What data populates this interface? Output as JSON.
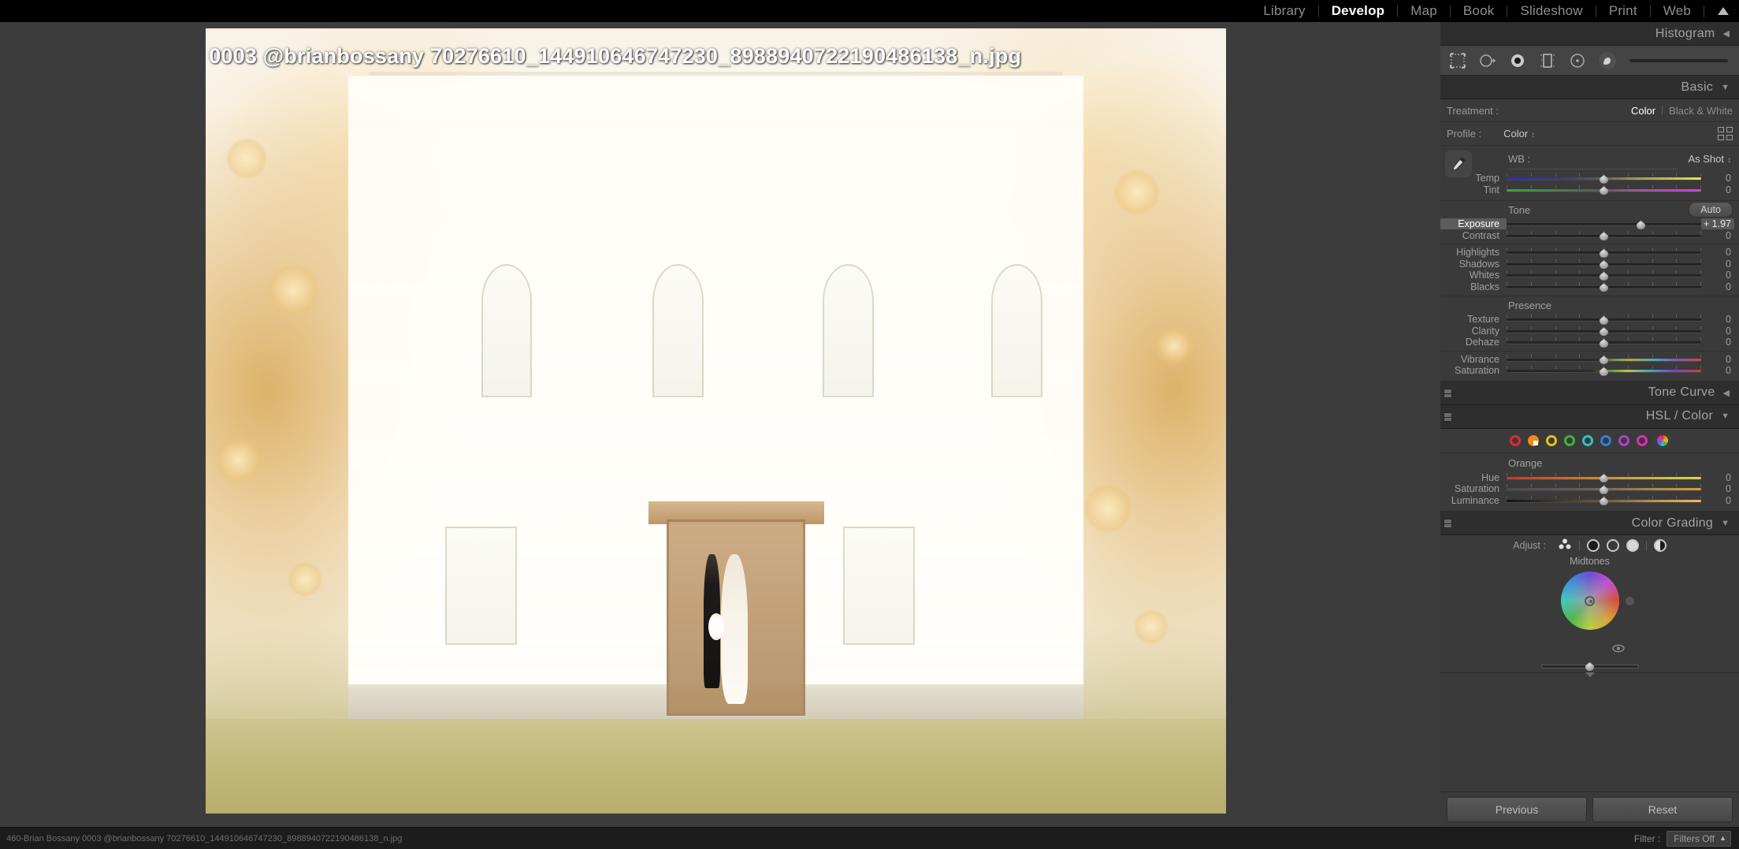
{
  "topbar": {
    "modules": [
      {
        "label": "Library",
        "active": false
      },
      {
        "label": "Develop",
        "active": true
      },
      {
        "label": "Map",
        "active": false
      },
      {
        "label": "Book",
        "active": false
      },
      {
        "label": "Slideshow",
        "active": false
      },
      {
        "label": "Print",
        "active": false
      },
      {
        "label": "Web",
        "active": false
      }
    ]
  },
  "photo": {
    "title": "460-Brian Bossany 0003 @brianbossany 70276610_144910646747230_8988940722190486138_n.jpg"
  },
  "right_panel": {
    "histogram": {
      "title": "Histogram",
      "arrow": "◀"
    },
    "tools": [
      {
        "name": "crop-overlay-tool"
      },
      {
        "name": "spot-removal-tool"
      },
      {
        "name": "red-eye-tool"
      },
      {
        "name": "graduated-filter-tool"
      },
      {
        "name": "radial-filter-tool"
      },
      {
        "name": "adjustment-brush-tool"
      }
    ],
    "basic": {
      "title": "Basic",
      "arrow": "▼",
      "treatment_label": "Treatment :",
      "treatment_options": [
        {
          "label": "Color",
          "active": true
        },
        {
          "label": "Black & White",
          "active": false
        }
      ],
      "profile_label": "Profile :",
      "profile_value": "Color",
      "wb_label": "WB :",
      "wb_value": "As Shot",
      "wb_sliders": [
        {
          "name": "Temp",
          "value": "0",
          "pos": 50,
          "gradient": "temp"
        },
        {
          "name": "Tint",
          "value": "0",
          "pos": 50,
          "gradient": "tint"
        }
      ],
      "tone_label": "Tone",
      "auto_label": "Auto",
      "tone_sliders": [
        {
          "name": "Exposure",
          "value": "+ 1.97",
          "pos": 69,
          "highlight": true
        },
        {
          "name": "Contrast",
          "value": "0",
          "pos": 50,
          "highlight": false
        },
        {
          "name": "Highlights",
          "value": "0",
          "pos": 50,
          "highlight": false
        },
        {
          "name": "Shadows",
          "value": "0",
          "pos": 50,
          "highlight": false
        },
        {
          "name": "Whites",
          "value": "0",
          "pos": 50,
          "highlight": false
        },
        {
          "name": "Blacks",
          "value": "0",
          "pos": 50,
          "highlight": false
        }
      ],
      "presence_label": "Presence",
      "presence_sliders": [
        {
          "name": "Texture",
          "value": "0",
          "pos": 50,
          "gradient": "none"
        },
        {
          "name": "Clarity",
          "value": "0",
          "pos": 50,
          "gradient": "none"
        },
        {
          "name": "Dehaze",
          "value": "0",
          "pos": 50,
          "gradient": "none"
        },
        {
          "name": "Vibrance",
          "value": "0",
          "pos": 50,
          "gradient": "rainbow"
        },
        {
          "name": "Saturation",
          "value": "0",
          "pos": 50,
          "gradient": "rainbow"
        }
      ]
    },
    "tone_curve": {
      "title": "Tone Curve",
      "arrow": "◀"
    },
    "hsl": {
      "title": "HSL / Color",
      "arrow": "▼",
      "swatches": [
        {
          "name": "red",
          "color": "#e02b2b",
          "selected": false
        },
        {
          "name": "orange",
          "color": "#ef8a1b",
          "selected": true
        },
        {
          "name": "yellow",
          "color": "#e0c41b",
          "selected": false
        },
        {
          "name": "green",
          "color": "#3fb33f",
          "selected": false
        },
        {
          "name": "aqua",
          "color": "#2cc4c4",
          "selected": false
        },
        {
          "name": "blue",
          "color": "#2d7fe0",
          "selected": false
        },
        {
          "name": "purple",
          "color": "#b23fd0",
          "selected": false
        },
        {
          "name": "magenta",
          "color": "#e02bb8",
          "selected": false
        },
        {
          "name": "all",
          "color": "#888888",
          "selected": false
        }
      ],
      "channel_label": "Orange",
      "sliders": [
        {
          "name": "Hue",
          "value": "0",
          "pos": 50,
          "gradient": "hue-orange"
        },
        {
          "name": "Saturation",
          "value": "0",
          "pos": 50,
          "gradient": "sat-orange"
        },
        {
          "name": "Luminance",
          "value": "0",
          "pos": 50,
          "gradient": "lum-orange"
        }
      ]
    },
    "color_grading": {
      "title": "Color Grading",
      "arrow": "▼",
      "adjust_label": "Adjust :",
      "buttons": [
        {
          "name": "all-wheels"
        },
        {
          "name": "shadows"
        },
        {
          "name": "midtones"
        },
        {
          "name": "highlights"
        },
        {
          "name": "global"
        }
      ],
      "wheel_label": "Midtones"
    },
    "footer": {
      "previous_label": "Previous",
      "reset_label": "Reset"
    }
  },
  "bottombar": {
    "info": "460-Brian Bossany 0003 @brianbossany 70276610_144910646747230_8988940722190486138_n.jpg",
    "filter_label": "Filter :",
    "filter_value": "Filters Off",
    "chevron": "▲"
  }
}
